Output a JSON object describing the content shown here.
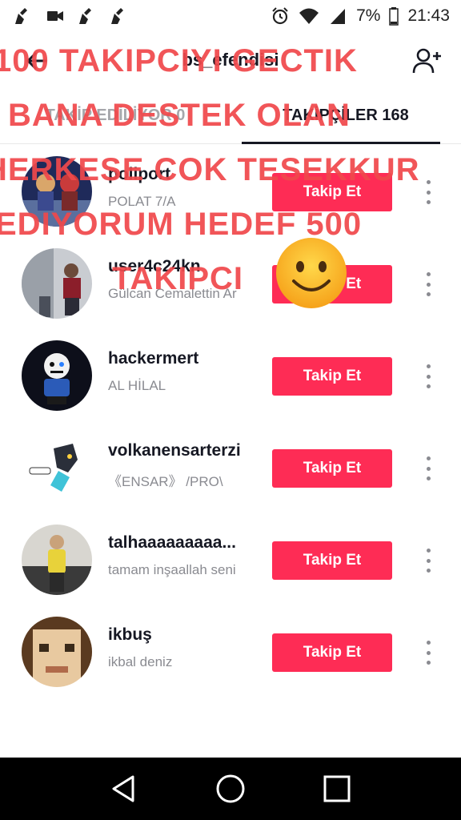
{
  "status_bar": {
    "battery": "7%",
    "time": "21:43",
    "left_icons": [
      "cleaner-icon",
      "video-icon",
      "cleaner-icon",
      "cleaner-icon"
    ],
    "right_icons": [
      "alarm-icon",
      "wifi-icon",
      "signal-icon",
      "battery-icon"
    ]
  },
  "header": {
    "title": "bs_efendisi"
  },
  "tabs": [
    {
      "label": "TAKİP EDİLİYOR 0",
      "active": false
    },
    {
      "label": "TAKİPÇİLER 168",
      "active": true
    }
  ],
  "followers": [
    {
      "username": "poliport",
      "nickname": "POLAT 7/A",
      "button": "Takip Et"
    },
    {
      "username": "user4c24kn",
      "nickname": "Gülcan Cemalettin Ar",
      "button": "Takip Et"
    },
    {
      "username": "hackermert",
      "nickname": "AL HİLAL",
      "button": "Takip Et"
    },
    {
      "username": "volkanensarterzi",
      "nickname": "《ENSAR》 /PRO\\",
      "button": "Takip Et"
    },
    {
      "username": "talhaaaaaaaaa...",
      "nickname": "tamam inşaallah seni",
      "button": "Takip Et"
    },
    {
      "username": "ikbuş",
      "nickname": "ikbal  deniz",
      "button": "Takip Et"
    }
  ],
  "overlay": {
    "lines": [
      "100 TAKIPCIYI GECTIK",
      "BANA DESTEK OLAN",
      "HERKESE COK TESEKKUR",
      "EDIYORUM HEDEF 500",
      "TAKIPCI"
    ],
    "color": "#f0494c"
  },
  "colors": {
    "accent": "#fe2c55",
    "text": "#161823",
    "secondary": "#8a8b91"
  },
  "nav": [
    "back-triangle-icon",
    "home-circle-icon",
    "recents-square-icon"
  ]
}
